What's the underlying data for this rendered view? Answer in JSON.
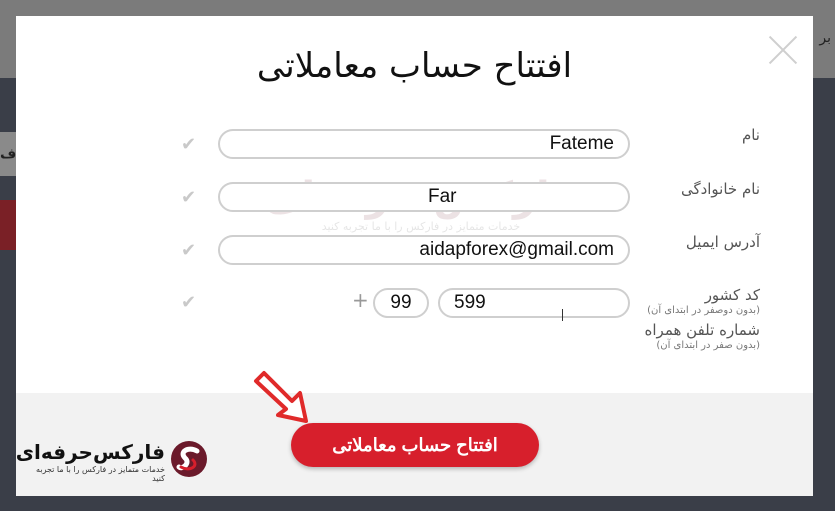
{
  "background": {
    "edge_text_right": "بر",
    "edge_text_left": "ف"
  },
  "modal": {
    "title": "افتتاح حساب معاملاتی",
    "close_icon": "close-icon",
    "fields": {
      "first_name": {
        "label": "نام",
        "value": "Fateme"
      },
      "last_name": {
        "label": "نام خانوادگی",
        "value": "Far"
      },
      "email": {
        "label": "آدرس ایمیل",
        "value": "aidapforex@gmail.com"
      },
      "phone": {
        "country_label": "کد کشور",
        "country_hint": "(بدون دوصفر در ابتدای آن)",
        "phone_label": "شماره تلفن همراه",
        "phone_hint": "(بدون صفر در ابتدای آن)",
        "plus": "+",
        "country_code": "99",
        "number": "599"
      }
    },
    "check_icon": "check-icon",
    "submit_label": "افتتاح حساب معاملاتی",
    "arrow_icon": "arrow-down-right-icon"
  },
  "logo": {
    "name": "فارکس‌حرفه‌ای",
    "tagline": "خدمات متمایز در فارکس را با ما تجربه کنید"
  },
  "watermark": {
    "name": "فارکس حرفه‌ای",
    "tagline": "خدمات متمایز در فارکس را با ما تجربه کنید"
  },
  "colors": {
    "accent": "#d71f2c",
    "brand_dark": "#6b1a2b"
  }
}
